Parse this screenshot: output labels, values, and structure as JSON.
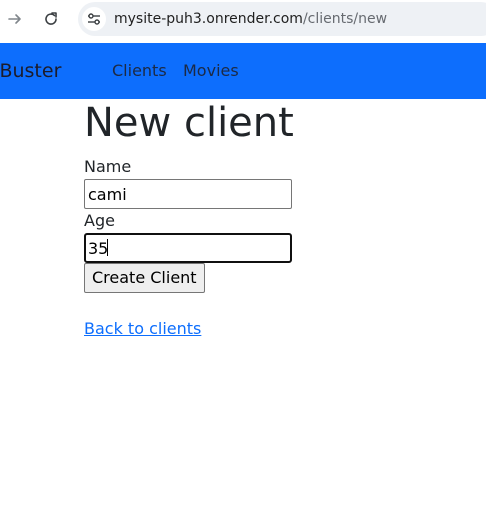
{
  "browser": {
    "url_host": "mysite-puh3.onrender.com",
    "url_path": "/clients/new",
    "icons": [
      "forward-icon",
      "reload-icon",
      "site-info-icon"
    ]
  },
  "navbar": {
    "brand": "ckBuster",
    "links": [
      {
        "label": "Clients"
      },
      {
        "label": "Movies"
      }
    ],
    "bg_color": "#0d6efd"
  },
  "page": {
    "title": "New client"
  },
  "form": {
    "name_label": "Name",
    "name_value": "cami",
    "age_label": "Age",
    "age_value": "35",
    "submit_label": "Create Client"
  },
  "back_link": {
    "label": "Back to clients",
    "color": "#0d6efd"
  }
}
